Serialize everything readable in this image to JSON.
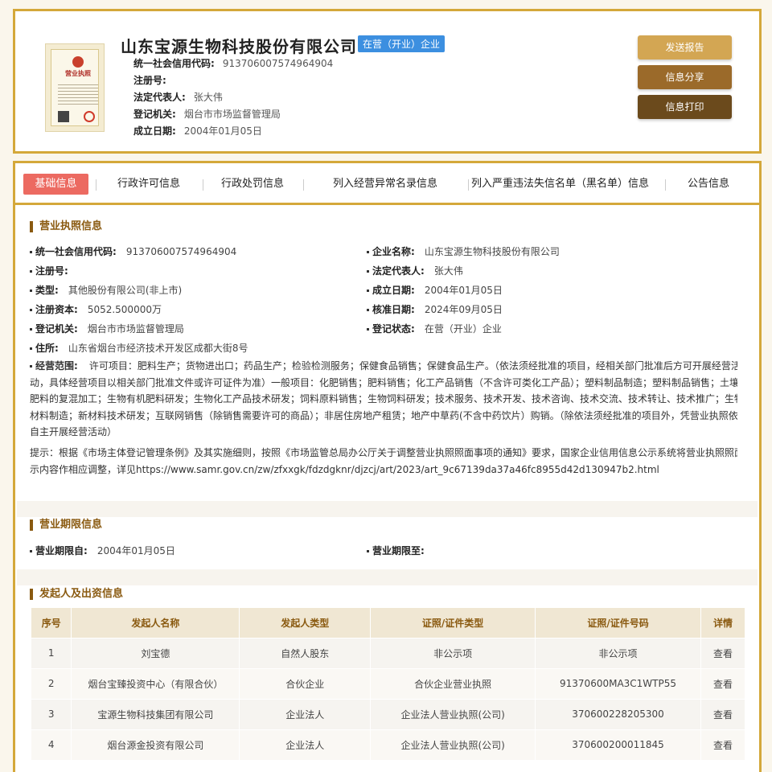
{
  "company": {
    "name": "山东宝源生物科技股份有限公司",
    "status": "在营（开业）企业",
    "fields": [
      {
        "label": "统一社会信用代码:",
        "value": "913706007574964904"
      },
      {
        "label": "注册号:",
        "value": ""
      },
      {
        "label": "法定代表人:",
        "value": "张大伟"
      },
      {
        "label": "登记机关:",
        "value": "烟台市市场监督管理局"
      },
      {
        "label": "成立日期:",
        "value": "2004年01月05日"
      }
    ]
  },
  "license_image": {
    "title": "营业执照"
  },
  "actions": {
    "send_report": "发送报告",
    "share": "信息分享",
    "print": "信息打印"
  },
  "tabs": [
    "基础信息",
    "行政许可信息",
    "行政处罚信息",
    "列入经营异常名录信息",
    "列入严重违法失信名单（黑名单）信息",
    "公告信息"
  ],
  "license_section": {
    "title": "营业执照信息",
    "left": [
      {
        "label": "统一社会信用代码:",
        "value": "913706007574964904"
      },
      {
        "label": "注册号:",
        "value": ""
      },
      {
        "label": "类型:",
        "value": "其他股份有限公司(非上市)"
      },
      {
        "label": "注册资本:",
        "value": "5052.500000万"
      },
      {
        "label": "登记机关:",
        "value": "烟台市市场监督管理局"
      },
      {
        "label": "住所:",
        "value": "山东省烟台市经济技术开发区成都大街8号"
      }
    ],
    "right": [
      {
        "label": "企业名称:",
        "value": "山东宝源生物科技股份有限公司"
      },
      {
        "label": "法定代表人:",
        "value": "张大伟"
      },
      {
        "label": "成立日期:",
        "value": "2004年01月05日"
      },
      {
        "label": "核准日期:",
        "value": "2024年09月05日"
      },
      {
        "label": "登记状态:",
        "value": "在营（开业）企业"
      }
    ],
    "scope_label": "经营范围:",
    "scope_lines": [
      "许可项目：肥料生产；货物进出口；药品生产；检验检测服务；保健食品销售；保健食品生产。（依法须经批准的项目，经相关部门批准后方可开展经营活",
      "动，具体经营项目以相关部门批准文件或许可证件为准）一般项目：化肥销售；肥料销售；化工产品销售（不含许可类化工产品）；塑料制品制造；塑料制品销售；土壤与",
      "肥料的复混加工；生物有机肥料研发；生物化工产品技术研发；饲料原料销售；生物饲料研发；技术服务、技术开发、技术咨询、技术交流、技术转让、技术推广；生物基",
      "材料制造；新材料技术研发；互联网销售（除销售需要许可的商品）；非居住房地产租赁；地产中草药(不含中药饮片）购销。（除依法须经批准的项目外，凭营业执照依法",
      "自主开展经营活动）"
    ],
    "notice_lines": [
      "提示：根据《市场主体登记管理条例》及其实施细则，按照《市场监管总局办公厅关于调整营业执照照面事项的通知》要求，国家企业信用信息公示系统将营业执照照面公",
      "示内容作相应调整，详见https://www.samr.gov.cn/zw/zfxxgk/fdzdgknr/djzcj/art/2023/art_9c67139da37a46fc8955d42d130947b2.html"
    ]
  },
  "period_section": {
    "title": "营业期限信息",
    "from_label": "营业期限自:",
    "from_value": "2004年01月05日",
    "to_label": "营业期限至:",
    "to_value": ""
  },
  "investor_section": {
    "title": "发起人及出资信息",
    "columns": [
      "序号",
      "发起人名称",
      "发起人类型",
      "证照/证件类型",
      "证照/证件号码",
      "详情"
    ],
    "rows": [
      [
        "1",
        "刘宝德",
        "自然人股东",
        "非公示项",
        "非公示项",
        "查看"
      ],
      [
        "2",
        "烟台宝臻投资中心（有限合伙）",
        "合伙企业",
        "合伙企业营业执照",
        "91370600MA3C1WTP55",
        "查看"
      ],
      [
        "3",
        "宝源生物科技集团有限公司",
        "企业法人",
        "企业法人营业执照(公司)",
        "370600228205300",
        "查看"
      ],
      [
        "4",
        "烟台源金投资有限公司",
        "企业法人",
        "企业法人营业执照(公司)",
        "370600200011845",
        "查看"
      ]
    ]
  }
}
